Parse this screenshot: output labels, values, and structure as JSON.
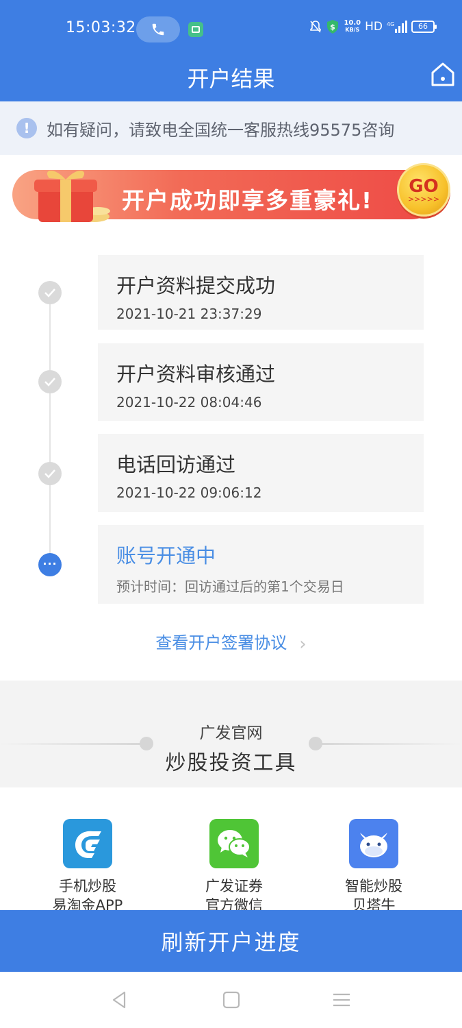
{
  "status_bar": {
    "time": "15:03:32",
    "speed_top": "10.0",
    "speed_unit": "KB/S",
    "hd": "HD",
    "network": "4G",
    "battery": "66"
  },
  "header": {
    "title": "开户结果"
  },
  "notice": {
    "icon": "!",
    "text": "如有疑问，请致电全国统一客服热线95575咨询"
  },
  "banner": {
    "text": "开户成功即享多重豪礼!",
    "go_label": "GO",
    "go_arrows": ">>>>>"
  },
  "timeline": [
    {
      "title": "开户资料提交成功",
      "sub": "2021-10-21 23:37:29",
      "state": "done"
    },
    {
      "title": "开户资料审核通过",
      "sub": "2021-10-22 08:04:46",
      "state": "done"
    },
    {
      "title": "电话回访通过",
      "sub": "2021-10-22 09:06:12",
      "state": "done"
    },
    {
      "title": "账号开通中",
      "sub": "预计时间：回访通过后的第1个交易日",
      "state": "active"
    }
  ],
  "agreement_link": "查看开户签署协议",
  "tools": {
    "subtitle": "广发官网",
    "title": "炒股投资工具",
    "apps": [
      {
        "line1": "手机炒股",
        "line2": "易淘金APP",
        "color": "#2a98dc"
      },
      {
        "line1": "广发证券",
        "line2": "官方微信",
        "color": "#4fc536"
      },
      {
        "line1": "智能炒股",
        "line2": "贝塔牛",
        "color": "#4c82ee"
      }
    ]
  },
  "refresh_button": "刷新开户进度",
  "colors": {
    "primary": "#3e7ee3",
    "link": "#4a8ee4"
  }
}
